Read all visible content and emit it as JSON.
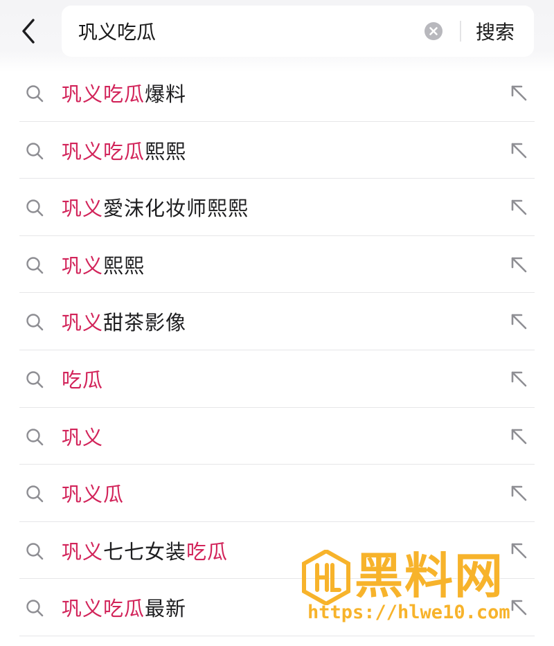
{
  "header": {
    "back_icon": "chevron-left-icon",
    "search_value": "巩义吃瓜",
    "clear_icon": "clear-circle-icon",
    "search_label": "搜索"
  },
  "colors": {
    "highlight": "#d2245a",
    "text": "#1d1d1f",
    "icon": "#8e8e93",
    "watermark": "#f7b32b"
  },
  "suggestions": [
    {
      "segments": [
        {
          "text": "巩义吃瓜",
          "hl": true
        },
        {
          "text": "爆料",
          "hl": false
        }
      ]
    },
    {
      "segments": [
        {
          "text": "巩义吃瓜",
          "hl": true
        },
        {
          "text": "熙熙",
          "hl": false
        }
      ]
    },
    {
      "segments": [
        {
          "text": "巩义",
          "hl": true
        },
        {
          "text": "愛沫化妆师熙熙",
          "hl": false
        }
      ]
    },
    {
      "segments": [
        {
          "text": "巩义",
          "hl": true
        },
        {
          "text": "熙熙",
          "hl": false
        }
      ]
    },
    {
      "segments": [
        {
          "text": "巩义",
          "hl": true
        },
        {
          "text": "甜茶影像",
          "hl": false
        }
      ]
    },
    {
      "segments": [
        {
          "text": "吃瓜",
          "hl": true
        }
      ]
    },
    {
      "segments": [
        {
          "text": "巩义",
          "hl": true
        }
      ]
    },
    {
      "segments": [
        {
          "text": "巩义瓜",
          "hl": true
        }
      ]
    },
    {
      "segments": [
        {
          "text": "巩义",
          "hl": true
        },
        {
          "text": "七七女装",
          "hl": false
        },
        {
          "text": "吃瓜",
          "hl": true
        }
      ]
    },
    {
      "segments": [
        {
          "text": "巩义吃瓜",
          "hl": true
        },
        {
          "text": "最新",
          "hl": false
        }
      ]
    }
  ],
  "watermark": {
    "title": "黑料网",
    "url": "https://hlwe10.com"
  }
}
